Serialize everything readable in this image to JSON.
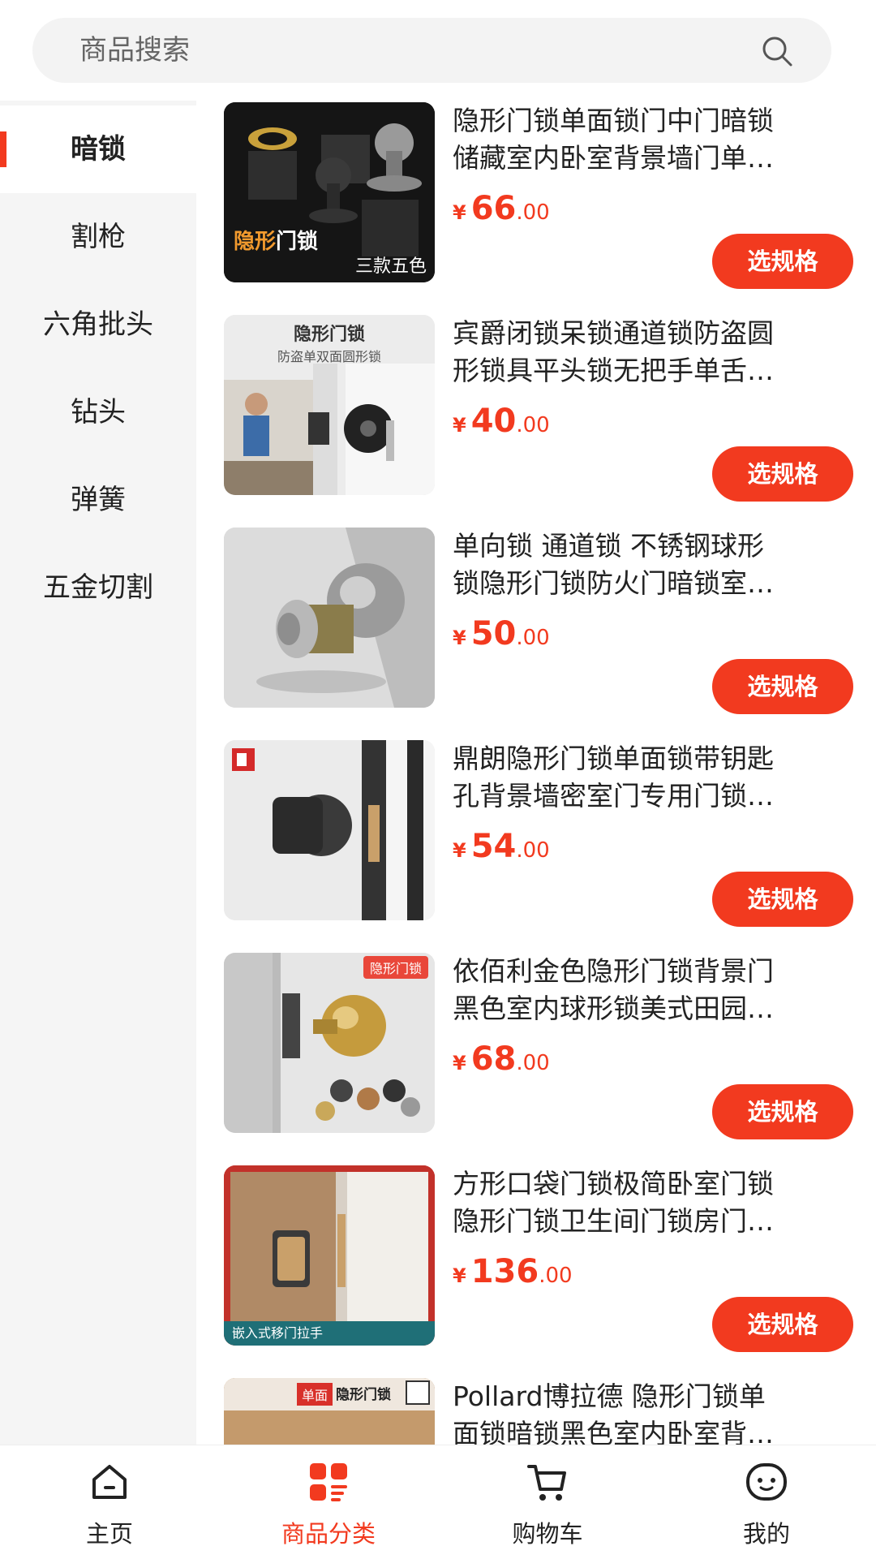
{
  "search": {
    "placeholder": "商品搜索"
  },
  "sidebar": {
    "items": [
      {
        "label": "暗锁",
        "active": true
      },
      {
        "label": "割枪"
      },
      {
        "label": "六角批头"
      },
      {
        "label": "钻头"
      },
      {
        "label": "弹簧"
      },
      {
        "label": "五金切割"
      }
    ]
  },
  "products": [
    {
      "title_line1": "隐形门锁单面锁门中门暗锁",
      "title_line2": "储藏室内卧室背景墙门单…",
      "currency": "¥",
      "price_int": "66",
      "price_dec": ".00",
      "button": "选规格",
      "image": {
        "label_hl": "隐形",
        "label": "门锁",
        "sub": "三款五色"
      }
    },
    {
      "title_line1": "宾爵闭锁呆锁通道锁防盗圆",
      "title_line2": "形锁具平头锁无把手单舌…",
      "currency": "¥",
      "price_int": "40",
      "price_dec": ".00",
      "button": "选规格",
      "image": {
        "title": "隐形门锁",
        "subtitle": "防盗单双面圆形锁"
      }
    },
    {
      "title_line1": "单向锁 通道锁 不锈钢球形",
      "title_line2": "锁隐形门锁防火门暗锁室…",
      "currency": "¥",
      "price_int": "50",
      "price_dec": ".00",
      "button": "选规格"
    },
    {
      "title_line1": "鼎朗隐形门锁单面锁带钥匙",
      "title_line2": "孔背景墙密室门专用门锁…",
      "currency": "¥",
      "price_int": "54",
      "price_dec": ".00",
      "button": "选规格"
    },
    {
      "title_line1": "依佰利金色隐形门锁背景门",
      "title_line2": "黑色室内球形锁美式田园…",
      "currency": "¥",
      "price_int": "68",
      "price_dec": ".00",
      "button": "选规格",
      "image": {
        "tag": "隐形门锁"
      }
    },
    {
      "title_line1": "方形口袋门锁极简卧室门锁",
      "title_line2": "隐形门锁卫生间门锁房门…",
      "currency": "¥",
      "price_int": "136",
      "price_dec": ".00",
      "button": "选规格",
      "image": {
        "bottom": "嵌入式移门拉手"
      }
    },
    {
      "title_line1": "Pollard博拉德 隐形门锁单",
      "title_line2": "面锁暗锁黑色室内卧室背…",
      "image": {
        "tag1": "单面",
        "tag2": "隐形门锁"
      }
    }
  ],
  "tabbar": [
    {
      "label": "主页",
      "icon": "home-icon"
    },
    {
      "label": "商品分类",
      "icon": "category-icon",
      "active": true
    },
    {
      "label": "购物车",
      "icon": "cart-icon"
    },
    {
      "label": "我的",
      "icon": "profile-icon"
    }
  ],
  "colors": {
    "accent": "#f23a1f",
    "sidebar_bg": "#f5f5f5"
  }
}
